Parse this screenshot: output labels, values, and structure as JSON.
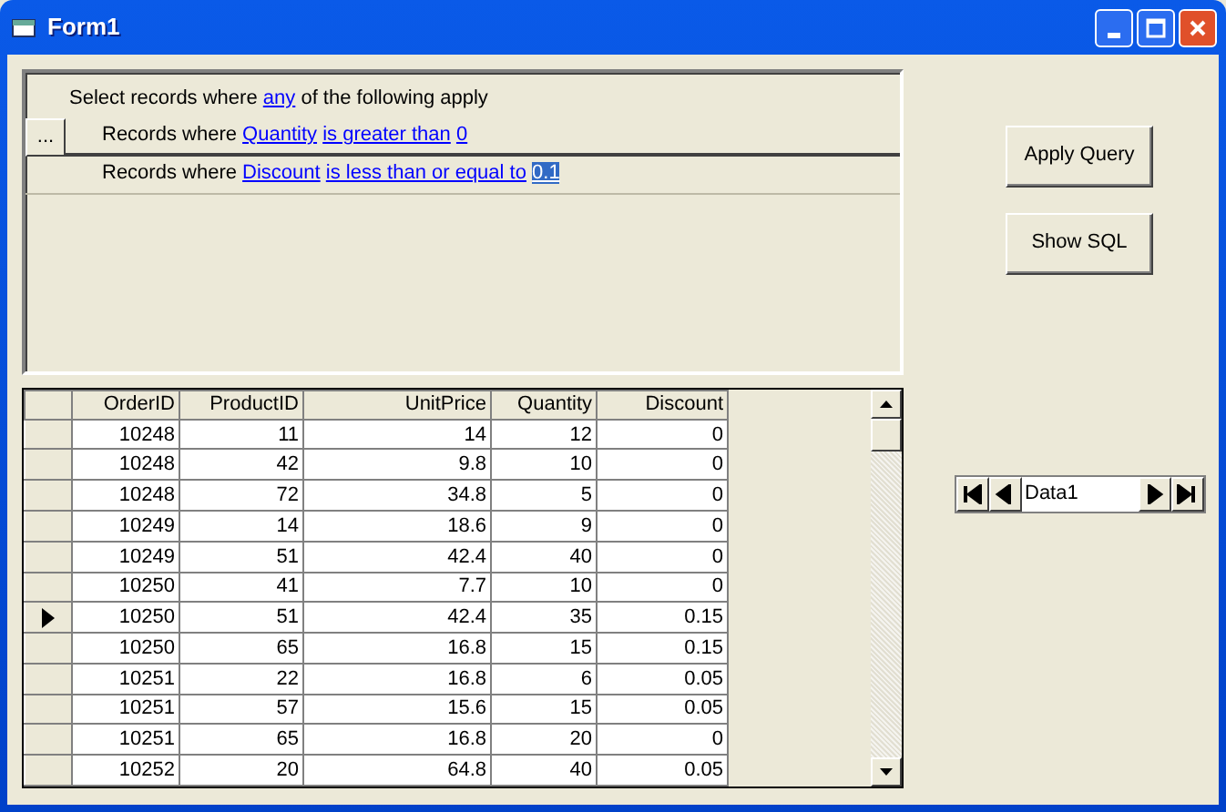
{
  "window": {
    "title": "Form1"
  },
  "query": {
    "intro": {
      "before": "Select records where",
      "link": "any",
      "after": "of the following apply"
    },
    "more_button": "...",
    "conditions": [
      {
        "prefix": "Records where",
        "field": "Quantity",
        "operator": "is greater than",
        "value": "0",
        "value_selected": false
      },
      {
        "prefix": "Records where",
        "field": "Discount",
        "operator": "is less than or equal to",
        "value": "0.1",
        "value_selected": true
      }
    ]
  },
  "buttons": [
    "Apply Query",
    "Show SQL"
  ],
  "grid": {
    "columns": [
      "OrderID",
      "ProductID",
      "UnitPrice",
      "Quantity",
      "Discount"
    ],
    "rows": [
      {
        "cells": [
          "10248",
          "11",
          "14",
          "12",
          "0"
        ],
        "current": false
      },
      {
        "cells": [
          "10248",
          "42",
          "9.8",
          "10",
          "0"
        ],
        "current": false
      },
      {
        "cells": [
          "10248",
          "72",
          "34.8",
          "5",
          "0"
        ],
        "current": false
      },
      {
        "cells": [
          "10249",
          "14",
          "18.6",
          "9",
          "0"
        ],
        "current": false
      },
      {
        "cells": [
          "10249",
          "51",
          "42.4",
          "40",
          "0"
        ],
        "current": false
      },
      {
        "cells": [
          "10250",
          "41",
          "7.7",
          "10",
          "0"
        ],
        "current": false
      },
      {
        "cells": [
          "10250",
          "51",
          "42.4",
          "35",
          "0.15"
        ],
        "current": true
      },
      {
        "cells": [
          "10250",
          "65",
          "16.8",
          "15",
          "0.15"
        ],
        "current": false
      },
      {
        "cells": [
          "10251",
          "22",
          "16.8",
          "6",
          "0.05"
        ],
        "current": false
      },
      {
        "cells": [
          "10251",
          "57",
          "15.6",
          "15",
          "0.05"
        ],
        "current": false
      },
      {
        "cells": [
          "10251",
          "65",
          "16.8",
          "20",
          "0"
        ],
        "current": false
      },
      {
        "cells": [
          "10252",
          "20",
          "64.8",
          "40",
          "0.05"
        ],
        "current": false
      }
    ]
  },
  "data_control": {
    "caption": "Data1"
  }
}
